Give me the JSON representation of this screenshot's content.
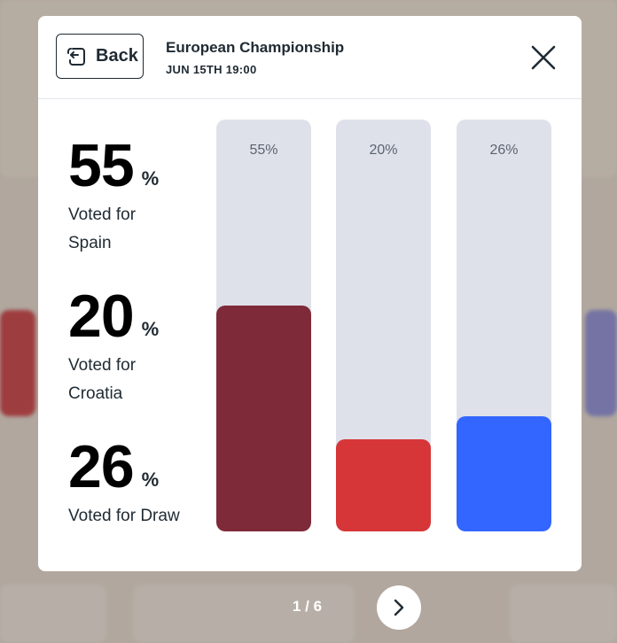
{
  "header": {
    "back_label": "Back",
    "title": "European Championship",
    "subtitle": "JUN 15TH 19:00"
  },
  "stats": [
    {
      "value": "55",
      "unit": "%",
      "label_line1": "Voted for",
      "label_line2": "Spain"
    },
    {
      "value": "20",
      "unit": "%",
      "label_line1": "Voted for",
      "label_line2": "Croatia"
    },
    {
      "value": "26",
      "unit": "%",
      "label_line1": "Voted for Draw",
      "label_line2": ""
    }
  ],
  "chart_data": {
    "type": "bar",
    "categories": [
      "Spain",
      "Croatia",
      "Draw"
    ],
    "values": [
      55,
      20,
      26
    ],
    "value_labels": [
      "55%",
      "20%",
      "26%"
    ],
    "ylim": [
      0,
      100
    ],
    "colors": [
      "#7e2a39",
      "#d63638",
      "#3366ff"
    ],
    "track_color": "#dfe1ea"
  },
  "pager": {
    "text": "1 / 6"
  },
  "icons": {
    "back": "back-arrow-icon",
    "close": "close-icon",
    "next": "chevron-right-icon"
  }
}
